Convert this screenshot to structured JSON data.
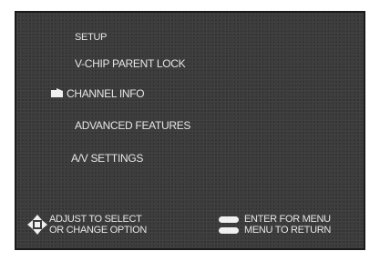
{
  "menu": {
    "title": "SETUP",
    "items": [
      {
        "label": "V-CHIP PARENT LOCK"
      },
      {
        "label": "CHANNEL INFO",
        "selected": true
      },
      {
        "label": "ADVANCED FEATURES"
      },
      {
        "label": "A/V SETTINGS"
      }
    ]
  },
  "footer": {
    "adjust_line1": "ADJUST  TO SELECT",
    "adjust_line2": "OR CHANGE  OPTION",
    "enter_line": "ENTER FOR MENU",
    "return_line": "MENU TO RETURN"
  },
  "icons": {
    "selection_cursor": "pointing-hand-icon",
    "adjust": "dpad-arrows-icon",
    "enter": "enter-button-icon",
    "menu": "menu-button-icon"
  },
  "colors": {
    "screen_bg": "#3a3a3a",
    "text": "#e6e6e6"
  }
}
